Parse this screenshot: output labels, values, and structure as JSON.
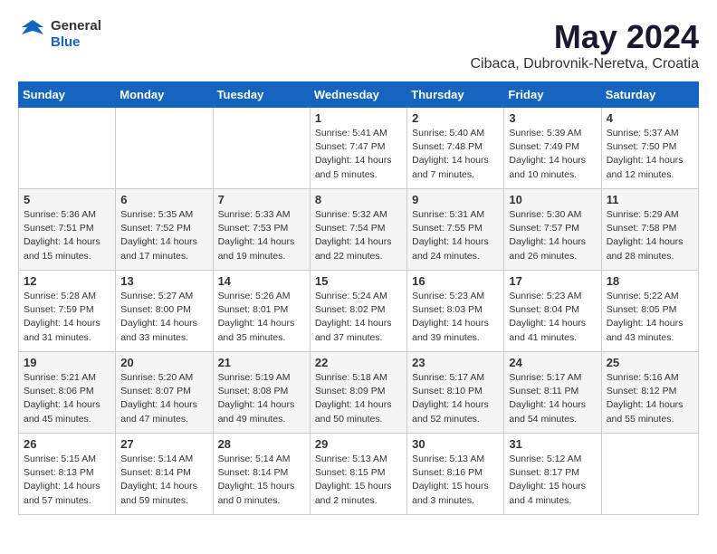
{
  "logo": {
    "general": "General",
    "blue": "Blue"
  },
  "title": "May 2024",
  "subtitle": "Cibaca, Dubrovnik-Neretva, Croatia",
  "headers": [
    "Sunday",
    "Monday",
    "Tuesday",
    "Wednesday",
    "Thursday",
    "Friday",
    "Saturday"
  ],
  "weeks": [
    [
      {
        "day": "",
        "info": ""
      },
      {
        "day": "",
        "info": ""
      },
      {
        "day": "",
        "info": ""
      },
      {
        "day": "1",
        "info": "Sunrise: 5:41 AM\nSunset: 7:47 PM\nDaylight: 14 hours\nand 5 minutes."
      },
      {
        "day": "2",
        "info": "Sunrise: 5:40 AM\nSunset: 7:48 PM\nDaylight: 14 hours\nand 7 minutes."
      },
      {
        "day": "3",
        "info": "Sunrise: 5:39 AM\nSunset: 7:49 PM\nDaylight: 14 hours\nand 10 minutes."
      },
      {
        "day": "4",
        "info": "Sunrise: 5:37 AM\nSunset: 7:50 PM\nDaylight: 14 hours\nand 12 minutes."
      }
    ],
    [
      {
        "day": "5",
        "info": "Sunrise: 5:36 AM\nSunset: 7:51 PM\nDaylight: 14 hours\nand 15 minutes."
      },
      {
        "day": "6",
        "info": "Sunrise: 5:35 AM\nSunset: 7:52 PM\nDaylight: 14 hours\nand 17 minutes."
      },
      {
        "day": "7",
        "info": "Sunrise: 5:33 AM\nSunset: 7:53 PM\nDaylight: 14 hours\nand 19 minutes."
      },
      {
        "day": "8",
        "info": "Sunrise: 5:32 AM\nSunset: 7:54 PM\nDaylight: 14 hours\nand 22 minutes."
      },
      {
        "day": "9",
        "info": "Sunrise: 5:31 AM\nSunset: 7:55 PM\nDaylight: 14 hours\nand 24 minutes."
      },
      {
        "day": "10",
        "info": "Sunrise: 5:30 AM\nSunset: 7:57 PM\nDaylight: 14 hours\nand 26 minutes."
      },
      {
        "day": "11",
        "info": "Sunrise: 5:29 AM\nSunset: 7:58 PM\nDaylight: 14 hours\nand 28 minutes."
      }
    ],
    [
      {
        "day": "12",
        "info": "Sunrise: 5:28 AM\nSunset: 7:59 PM\nDaylight: 14 hours\nand 31 minutes."
      },
      {
        "day": "13",
        "info": "Sunrise: 5:27 AM\nSunset: 8:00 PM\nDaylight: 14 hours\nand 33 minutes."
      },
      {
        "day": "14",
        "info": "Sunrise: 5:26 AM\nSunset: 8:01 PM\nDaylight: 14 hours\nand 35 minutes."
      },
      {
        "day": "15",
        "info": "Sunrise: 5:24 AM\nSunset: 8:02 PM\nDaylight: 14 hours\nand 37 minutes."
      },
      {
        "day": "16",
        "info": "Sunrise: 5:23 AM\nSunset: 8:03 PM\nDaylight: 14 hours\nand 39 minutes."
      },
      {
        "day": "17",
        "info": "Sunrise: 5:23 AM\nSunset: 8:04 PM\nDaylight: 14 hours\nand 41 minutes."
      },
      {
        "day": "18",
        "info": "Sunrise: 5:22 AM\nSunset: 8:05 PM\nDaylight: 14 hours\nand 43 minutes."
      }
    ],
    [
      {
        "day": "19",
        "info": "Sunrise: 5:21 AM\nSunset: 8:06 PM\nDaylight: 14 hours\nand 45 minutes."
      },
      {
        "day": "20",
        "info": "Sunrise: 5:20 AM\nSunset: 8:07 PM\nDaylight: 14 hours\nand 47 minutes."
      },
      {
        "day": "21",
        "info": "Sunrise: 5:19 AM\nSunset: 8:08 PM\nDaylight: 14 hours\nand 49 minutes."
      },
      {
        "day": "22",
        "info": "Sunrise: 5:18 AM\nSunset: 8:09 PM\nDaylight: 14 hours\nand 50 minutes."
      },
      {
        "day": "23",
        "info": "Sunrise: 5:17 AM\nSunset: 8:10 PM\nDaylight: 14 hours\nand 52 minutes."
      },
      {
        "day": "24",
        "info": "Sunrise: 5:17 AM\nSunset: 8:11 PM\nDaylight: 14 hours\nand 54 minutes."
      },
      {
        "day": "25",
        "info": "Sunrise: 5:16 AM\nSunset: 8:12 PM\nDaylight: 14 hours\nand 55 minutes."
      }
    ],
    [
      {
        "day": "26",
        "info": "Sunrise: 5:15 AM\nSunset: 8:13 PM\nDaylight: 14 hours\nand 57 minutes."
      },
      {
        "day": "27",
        "info": "Sunrise: 5:14 AM\nSunset: 8:14 PM\nDaylight: 14 hours\nand 59 minutes."
      },
      {
        "day": "28",
        "info": "Sunrise: 5:14 AM\nSunset: 8:14 PM\nDaylight: 15 hours\nand 0 minutes."
      },
      {
        "day": "29",
        "info": "Sunrise: 5:13 AM\nSunset: 8:15 PM\nDaylight: 15 hours\nand 2 minutes."
      },
      {
        "day": "30",
        "info": "Sunrise: 5:13 AM\nSunset: 8:16 PM\nDaylight: 15 hours\nand 3 minutes."
      },
      {
        "day": "31",
        "info": "Sunrise: 5:12 AM\nSunset: 8:17 PM\nDaylight: 15 hours\nand 4 minutes."
      },
      {
        "day": "",
        "info": ""
      }
    ]
  ]
}
